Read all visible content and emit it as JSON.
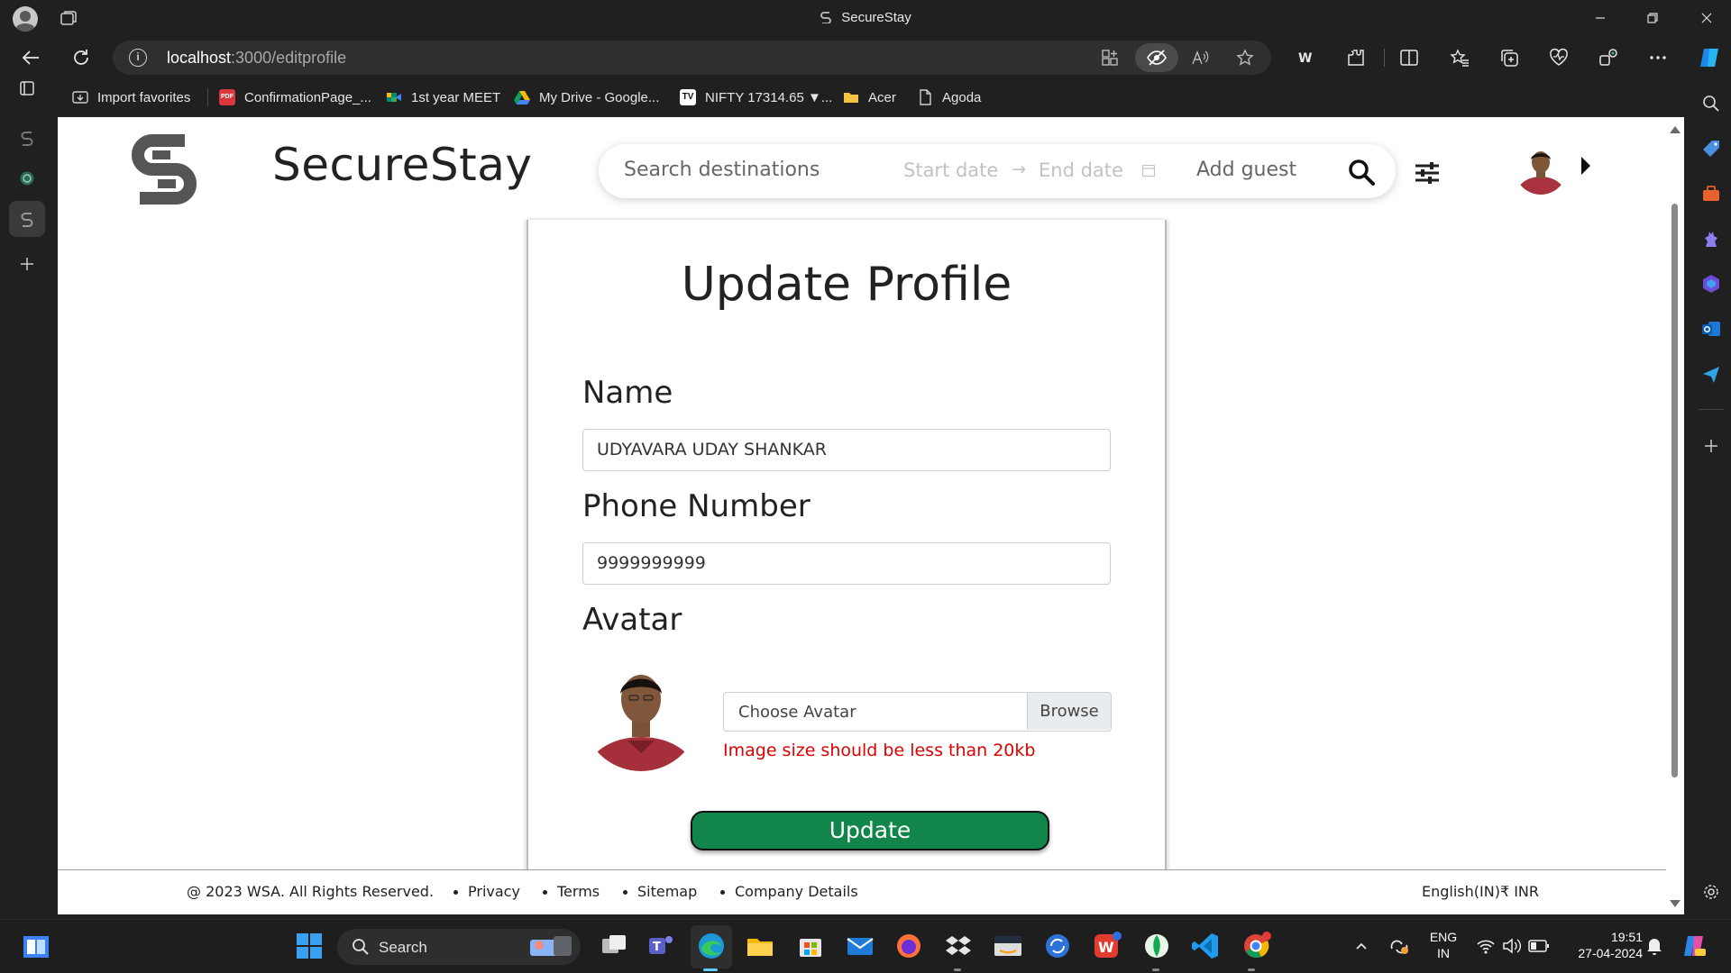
{
  "window": {
    "title": "SecureStay"
  },
  "address_bar": {
    "url_host": "localhost",
    "url_path": ":3000/editprofile"
  },
  "bookmarks": [
    {
      "label": "Import favorites",
      "icon": "import-icon",
      "color": "#cfcfcf"
    },
    {
      "label": "ConfirmationPage_...",
      "icon": "pdf-icon",
      "color": "#d9363e"
    },
    {
      "label": "1st year MEET",
      "icon": "meet-icon",
      "color": "#00897b"
    },
    {
      "label": "My Drive - Google...",
      "icon": "drive-icon",
      "color": "#fbbc04"
    },
    {
      "label": "NIFTY 17314.65 ▼...",
      "icon": "tradingview-icon",
      "color": "#ffffff"
    },
    {
      "label": "Acer",
      "icon": "folder-icon",
      "color": "#f4c542"
    },
    {
      "label": "Agoda",
      "icon": "page-icon",
      "color": "#cfcfcf"
    }
  ],
  "header": {
    "brand": "SecureStay",
    "search": {
      "destination_placeholder": "Search destinations",
      "start_placeholder": "Start date",
      "arrow": "→",
      "end_placeholder": "End date",
      "guest_placeholder": "Add guest"
    }
  },
  "form": {
    "title": "Update Profile",
    "name_label": "Name",
    "name_value": "UDYAVARA UDAY SHANKAR",
    "phone_label": "Phone Number",
    "phone_value": "9999999999",
    "avatar_label": "Avatar",
    "avatar_placeholder": "Choose Avatar",
    "browse_label": "Browse",
    "avatar_error": "Image size should be less than 20kb",
    "submit_label": "Update",
    "submit_color": "#12854a",
    "error_color": "#e00000"
  },
  "footer": {
    "copyright": "@ 2023 WSA. All Rights Reserved.",
    "links": [
      "Privacy",
      "Terms",
      "Sitemap",
      "Company Details"
    ],
    "locale": "English(IN)₹ INR"
  },
  "taskbar": {
    "search_label": "Search",
    "lang_top": "ENG",
    "lang_bottom": "IN",
    "time": "19:51",
    "date": "27-04-2024"
  }
}
